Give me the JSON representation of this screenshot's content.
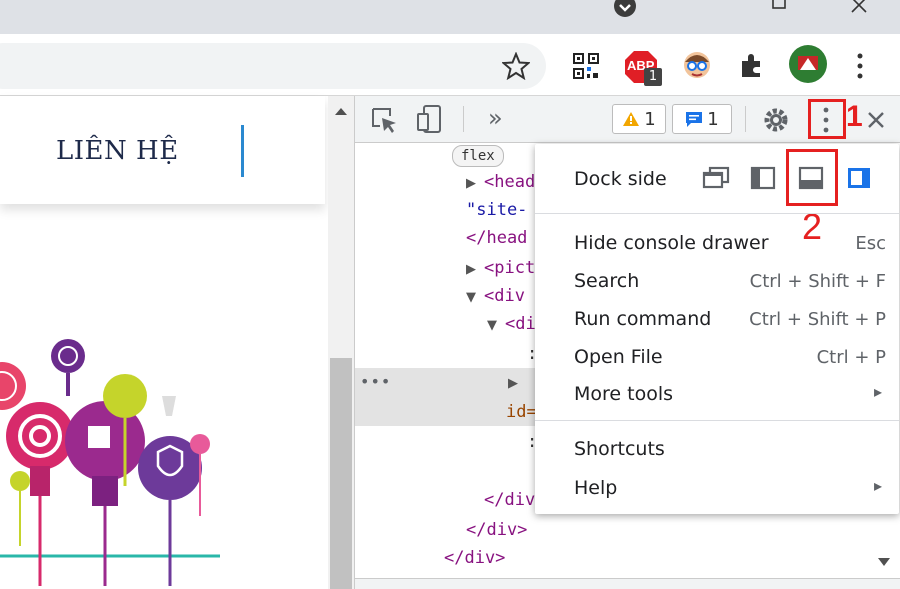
{
  "browser": {
    "extensions": [
      {
        "icon": "qr-code-icon"
      },
      {
        "icon": "adblock-icon",
        "label": "ABP",
        "badge": "1"
      },
      {
        "icon": "avatar-extension-icon"
      },
      {
        "icon": "puzzle-icon"
      },
      {
        "icon": "profile-icon"
      }
    ]
  },
  "page": {
    "nav_contact": "LIÊN HỆ"
  },
  "devtools": {
    "more_tabs": "»",
    "warnings_count": "1",
    "messages_count": "1",
    "flex_badge": "flex",
    "code_lines": [
      {
        "text": "<head",
        "indent": 0
      },
      {
        "text": "\"site-",
        "indent": 0
      },
      {
        "text": "</head",
        "indent": 0
      },
      {
        "text": "<pict",
        "indent": 0
      },
      {
        "text": "<div",
        "indent": 0
      },
      {
        "text": "<di",
        "indent": 1
      },
      {
        "text": "id=",
        "indent": 2
      },
      {
        "text": "</div>",
        "indent": 1
      },
      {
        "text": "</div>",
        "indent": 0
      }
    ],
    "menu": {
      "dock_side_label": "Dock side",
      "items": [
        {
          "label": "Hide console drawer",
          "shortcut": "Esc"
        },
        {
          "label": "Search",
          "shortcut": "Ctrl + Shift + F"
        },
        {
          "label": "Run command",
          "shortcut": "Ctrl + Shift + P"
        },
        {
          "label": "Open File",
          "shortcut": "Ctrl + P"
        },
        {
          "label": "More tools",
          "shortcut": "▸"
        },
        {
          "label": "Shortcuts",
          "shortcut": ""
        },
        {
          "label": "Help",
          "shortcut": "▸"
        }
      ]
    }
  },
  "annotations": {
    "step1": "1",
    "step2": "2",
    "color": "#e52020"
  }
}
